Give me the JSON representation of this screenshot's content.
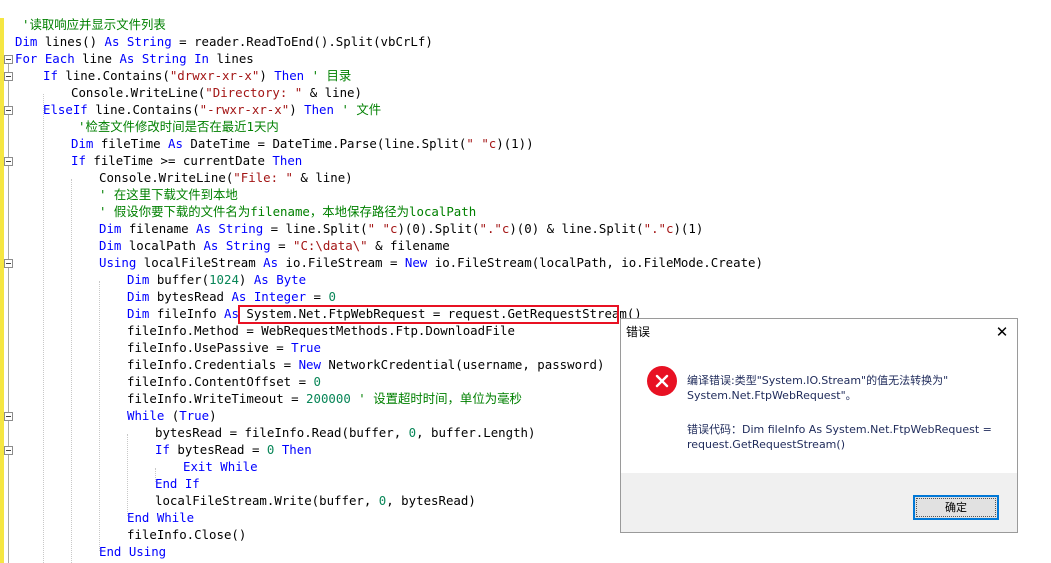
{
  "editor": {
    "lines": [
      [
        [
          "com",
          "'读取响应并显示文件列表"
        ]
      ],
      [
        [
          "kw",
          "Dim"
        ],
        [
          "",
          " lines() "
        ],
        [
          "kw",
          "As"
        ],
        [
          "",
          " "
        ],
        [
          "kw",
          "String"
        ],
        [
          "",
          " = reader.ReadToEnd().Split(vbCrLf)"
        ]
      ],
      [
        [
          "kw",
          "For Each"
        ],
        [
          "",
          " line "
        ],
        [
          "kw",
          "As"
        ],
        [
          "",
          " "
        ],
        [
          "kw",
          "String"
        ],
        [
          "",
          " "
        ],
        [
          "kw",
          "In"
        ],
        [
          "",
          " lines"
        ]
      ],
      [
        [
          "kw",
          "If"
        ],
        [
          "",
          " line.Contains("
        ],
        [
          "str",
          "\"drwxr-xr-x\""
        ],
        [
          "",
          ") "
        ],
        [
          "kw",
          "Then"
        ],
        [
          "",
          " "
        ],
        [
          "com",
          "' 目录"
        ]
      ],
      [
        [
          "",
          "Console.WriteLine("
        ],
        [
          "str",
          "\"Directory: \""
        ],
        [
          "",
          " & line)"
        ]
      ],
      [
        [
          "kw",
          "ElseIf"
        ],
        [
          "",
          " line.Contains("
        ],
        [
          "str",
          "\"-rwxr-xr-x\""
        ],
        [
          "",
          ") "
        ],
        [
          "kw",
          "Then"
        ],
        [
          "",
          " "
        ],
        [
          "com",
          "' 文件"
        ]
      ],
      [
        [
          "com",
          "'检查文件修改时间是否在最近1天内"
        ]
      ],
      [
        [
          "kw",
          "Dim"
        ],
        [
          "",
          " fileTime "
        ],
        [
          "kw",
          "As"
        ],
        [
          "",
          " DateTime = DateTime.Parse(line.Split("
        ],
        [
          "str",
          "\" \"c"
        ],
        [
          "",
          ")(1))"
        ]
      ],
      [
        [
          "kw",
          "If"
        ],
        [
          "",
          " fileTime >= currentDate "
        ],
        [
          "kw",
          "Then"
        ]
      ],
      [
        [
          "",
          "Console.WriteLine("
        ],
        [
          "str",
          "\"File: \""
        ],
        [
          "",
          " & line)"
        ]
      ],
      [
        [
          "com",
          "' 在这里下载文件到本地"
        ]
      ],
      [
        [
          "com",
          "' 假设你要下载的文件名为filename，本地保存路径为localPath"
        ]
      ],
      [
        [
          "kw",
          "Dim"
        ],
        [
          "",
          " filename "
        ],
        [
          "kw",
          "As"
        ],
        [
          "",
          " "
        ],
        [
          "kw",
          "String"
        ],
        [
          "",
          " = line.Split("
        ],
        [
          "str",
          "\" \"c"
        ],
        [
          "",
          ")(0).Split("
        ],
        [
          "str",
          "\".\"c"
        ],
        [
          "",
          ")(0) & line.Split("
        ],
        [
          "str",
          "\".\"c"
        ],
        [
          "",
          ")(1)"
        ]
      ],
      [
        [
          "kw",
          "Dim"
        ],
        [
          "",
          " localPath "
        ],
        [
          "kw",
          "As"
        ],
        [
          "",
          " "
        ],
        [
          "kw",
          "String"
        ],
        [
          "",
          " = "
        ],
        [
          "str",
          "\"C:\\data\\\""
        ],
        [
          "",
          " & filename"
        ]
      ],
      [
        [
          "kw",
          "Using"
        ],
        [
          "",
          " localFileStream "
        ],
        [
          "kw",
          "As"
        ],
        [
          "",
          " io.FileStream = "
        ],
        [
          "kw",
          "New"
        ],
        [
          "",
          " io.FileStream(localPath, io.FileMode.Create)"
        ]
      ],
      [
        [
          "kw",
          "Dim"
        ],
        [
          "",
          " buffer("
        ],
        [
          "num",
          "1024"
        ],
        [
          "",
          ") "
        ],
        [
          "kw",
          "As"
        ],
        [
          "",
          " "
        ],
        [
          "kw",
          "Byte"
        ]
      ],
      [
        [
          "kw",
          "Dim"
        ],
        [
          "",
          " bytesRead "
        ],
        [
          "kw",
          "As"
        ],
        [
          "",
          " "
        ],
        [
          "kw",
          "Integer"
        ],
        [
          "",
          " = "
        ],
        [
          "num",
          "0"
        ]
      ],
      [
        [
          "kw",
          "Dim"
        ],
        [
          "",
          " fileInfo "
        ],
        [
          "kw",
          "As"
        ],
        [
          "",
          " System.Net.FtpWebRequest = request.GetRequestStream()"
        ]
      ],
      [
        [
          "",
          "fileInfo.Method = WebRequestMethods.Ftp.DownloadFile"
        ]
      ],
      [
        [
          "",
          "fileInfo.UsePassive = "
        ],
        [
          "kw",
          "True"
        ]
      ],
      [
        [
          "",
          "fileInfo.Credentials = "
        ],
        [
          "kw",
          "New"
        ],
        [
          "",
          " NetworkCredential(username, password)"
        ]
      ],
      [
        [
          "",
          "fileInfo.ContentOffset = "
        ],
        [
          "num",
          "0"
        ]
      ],
      [
        [
          "",
          "fileInfo.WriteTimeout = "
        ],
        [
          "num",
          "200000"
        ],
        [
          "",
          " "
        ],
        [
          "com",
          "' 设置超时时间，单位为毫秒"
        ]
      ],
      [
        [
          "kw",
          "While"
        ],
        [
          "",
          " ("
        ],
        [
          "kw",
          "True"
        ],
        [
          "",
          ")"
        ]
      ],
      [
        [
          "",
          "bytesRead = fileInfo.Read(buffer, "
        ],
        [
          "num",
          "0"
        ],
        [
          "",
          ", buffer.Length)"
        ]
      ],
      [
        [
          "kw",
          "If"
        ],
        [
          "",
          " bytesRead = "
        ],
        [
          "num",
          "0"
        ],
        [
          "",
          " "
        ],
        [
          "kw",
          "Then"
        ]
      ],
      [
        [
          "kw",
          "Exit While"
        ]
      ],
      [
        [
          "kw",
          "End If"
        ]
      ],
      [
        [
          "",
          "localFileStream.Write(buffer, "
        ],
        [
          "num",
          "0"
        ],
        [
          "",
          ", bytesRead)"
        ]
      ],
      [
        [
          "kw",
          "End While"
        ]
      ],
      [
        [
          "",
          "fileInfo.Close()"
        ]
      ],
      [
        [
          "kw",
          "End Using"
        ]
      ]
    ]
  },
  "dialog": {
    "title": "错误",
    "close_label": "✕",
    "message_line1": "编译错误:类型\"System.IO.Stream\"的值无法转换为\"",
    "message_line2": "System.Net.FtpWebRequest\"。",
    "detail_line1": "错误代码：Dim fileInfo As System.Net.FtpWebRequest =",
    "detail_line2": "request.GetRequestStream()",
    "ok_label": "确定",
    "icon": "error-icon"
  }
}
